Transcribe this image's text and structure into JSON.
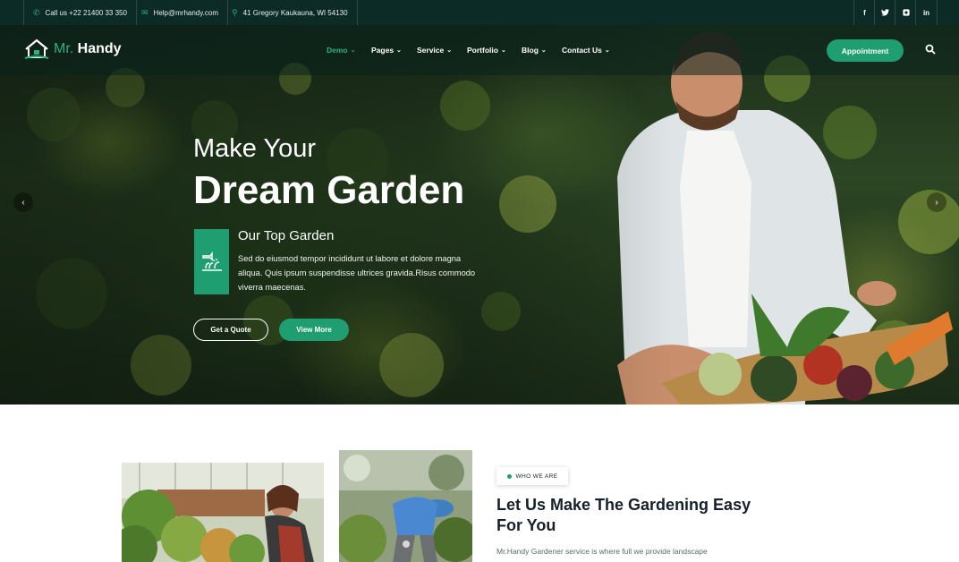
{
  "topbar": {
    "phone": "Call us +22 21400 33 350",
    "email": "Help@mrhandy.com",
    "address": "41 Gregory Kaukauna, WI 54130",
    "social": [
      {
        "icon": "facebook-icon",
        "label": "f"
      },
      {
        "icon": "twitter-icon",
        "label": "🐦"
      },
      {
        "icon": "instagram-icon",
        "label": "◘"
      },
      {
        "icon": "linkedin-icon",
        "label": "in"
      }
    ]
  },
  "brand": {
    "prefix": "Mr.",
    "name": "Handy"
  },
  "nav": {
    "items": [
      "Demo",
      "Pages",
      "Service",
      "Portfolio",
      "Blog",
      "Contact Us"
    ],
    "active": "Demo",
    "appointment_label": "Appointment"
  },
  "hero": {
    "line1": "Make Your",
    "line2": "Dream Garden",
    "subtitle": "Our Top Garden",
    "text": "Sed do eiusmod tempor incididunt ut labore et dolore magna aliqua. Quis ipsum suspendisse ultrices gravida.Risus commodo viverra maecenas.",
    "btn_quote": "Get a Quote",
    "btn_more": "View More"
  },
  "about": {
    "tag": "WHO WE ARE",
    "title": "Let Us Make The Gardening Easy For You",
    "text": "Mr.Handy Gardener service is where full we provide landscape"
  },
  "colors": {
    "accent": "#1f9e72",
    "dark": "#0c2a26"
  }
}
